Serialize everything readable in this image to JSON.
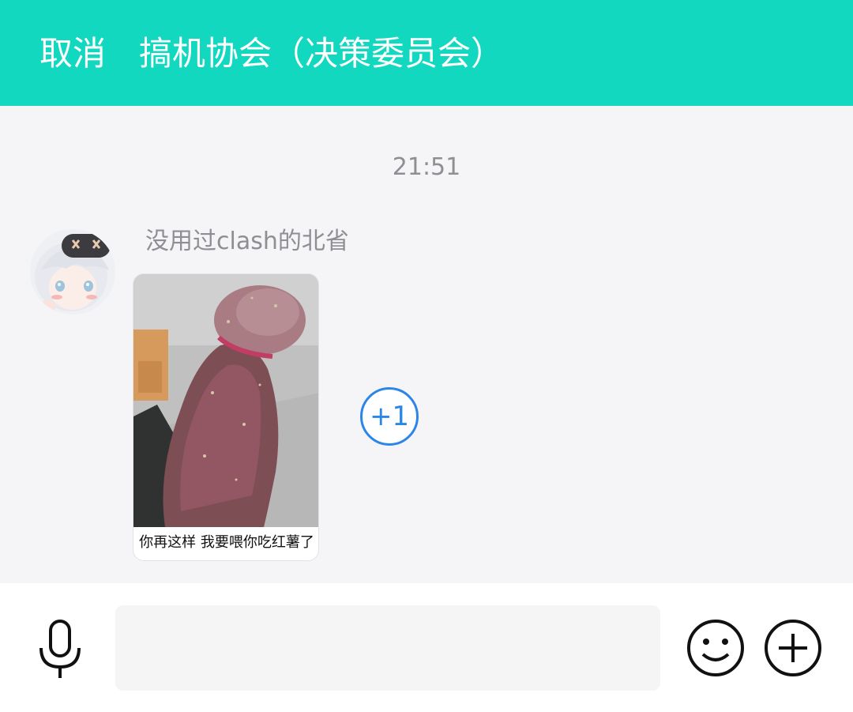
{
  "header": {
    "cancel_label": "取消",
    "title": "搞机协会（决策委员会）",
    "background_color": "#12d8c0"
  },
  "chat": {
    "timestamp": "21:51",
    "messages": [
      {
        "sender": "没用过clash的北省",
        "avatar_icon": "anime-avatar",
        "type": "sticker",
        "sticker_caption": "你再这样 我要喂你吃红薯了",
        "reaction_label": "+1"
      }
    ]
  },
  "input_bar": {
    "input_value": "",
    "voice_icon": "microphone-icon",
    "emoji_icon": "smiley-icon",
    "more_icon": "plus-circle-icon"
  }
}
